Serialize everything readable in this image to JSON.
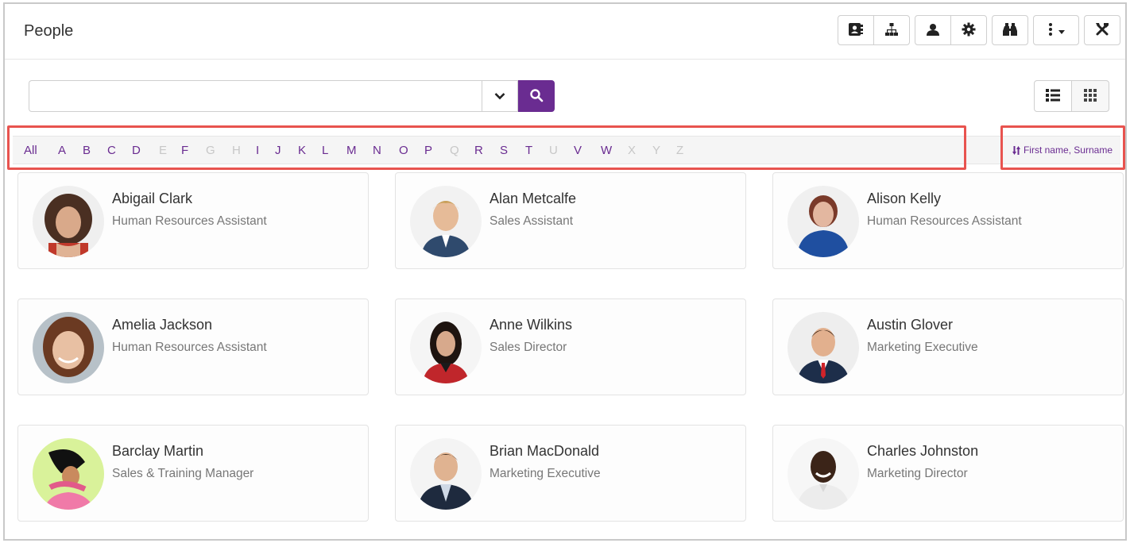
{
  "header": {
    "title": "People",
    "toolbar": [
      {
        "icon": "contact-card-icon"
      },
      {
        "icon": "org-chart-icon"
      },
      {
        "icon": "user-icon"
      },
      {
        "icon": "gear-icon"
      },
      {
        "icon": "binoculars-icon"
      },
      {
        "icon": "more-vertical-icon"
      },
      {
        "icon": "tools-icon"
      }
    ]
  },
  "search": {
    "placeholder": "",
    "value": ""
  },
  "view_modes": [
    {
      "icon": "list-view-icon"
    },
    {
      "icon": "grid-view-icon"
    }
  ],
  "alphabet": {
    "letters": [
      {
        "label": "All",
        "enabled": true
      },
      {
        "label": "A",
        "enabled": true
      },
      {
        "label": "B",
        "enabled": true
      },
      {
        "label": "C",
        "enabled": true
      },
      {
        "label": "D",
        "enabled": true
      },
      {
        "label": "E",
        "enabled": false
      },
      {
        "label": "F",
        "enabled": true
      },
      {
        "label": "G",
        "enabled": false
      },
      {
        "label": "H",
        "enabled": false
      },
      {
        "label": "I",
        "enabled": true
      },
      {
        "label": "J",
        "enabled": true
      },
      {
        "label": "K",
        "enabled": true
      },
      {
        "label": "L",
        "enabled": true
      },
      {
        "label": "M",
        "enabled": true
      },
      {
        "label": "N",
        "enabled": true
      },
      {
        "label": "O",
        "enabled": true
      },
      {
        "label": "P",
        "enabled": true
      },
      {
        "label": "Q",
        "enabled": false
      },
      {
        "label": "R",
        "enabled": true
      },
      {
        "label": "S",
        "enabled": true
      },
      {
        "label": "T",
        "enabled": true
      },
      {
        "label": "U",
        "enabled": false
      },
      {
        "label": "V",
        "enabled": true
      },
      {
        "label": "W",
        "enabled": true
      },
      {
        "label": "X",
        "enabled": false
      },
      {
        "label": "Y",
        "enabled": false
      },
      {
        "label": "Z",
        "enabled": false
      }
    ],
    "sort_label": "First name, Surname"
  },
  "people": [
    {
      "name": "Abigail Clark",
      "role": "Human Resources Assistant"
    },
    {
      "name": "Alan Metcalfe",
      "role": "Sales Assistant"
    },
    {
      "name": "Alison Kelly",
      "role": "Human Resources Assistant"
    },
    {
      "name": "Amelia Jackson",
      "role": "Human Resources Assistant"
    },
    {
      "name": "Anne Wilkins",
      "role": "Sales Director"
    },
    {
      "name": "Austin Glover",
      "role": "Marketing Executive"
    },
    {
      "name": "Barclay Martin",
      "role": "Sales & Training Manager"
    },
    {
      "name": "Brian MacDonald",
      "role": "Marketing Executive"
    },
    {
      "name": "Charles Johnston",
      "role": "Marketing Director"
    }
  ],
  "colors": {
    "accent": "#6a2c91",
    "highlight": "#e8534f",
    "disabled_letter": "#c7c7c7"
  }
}
